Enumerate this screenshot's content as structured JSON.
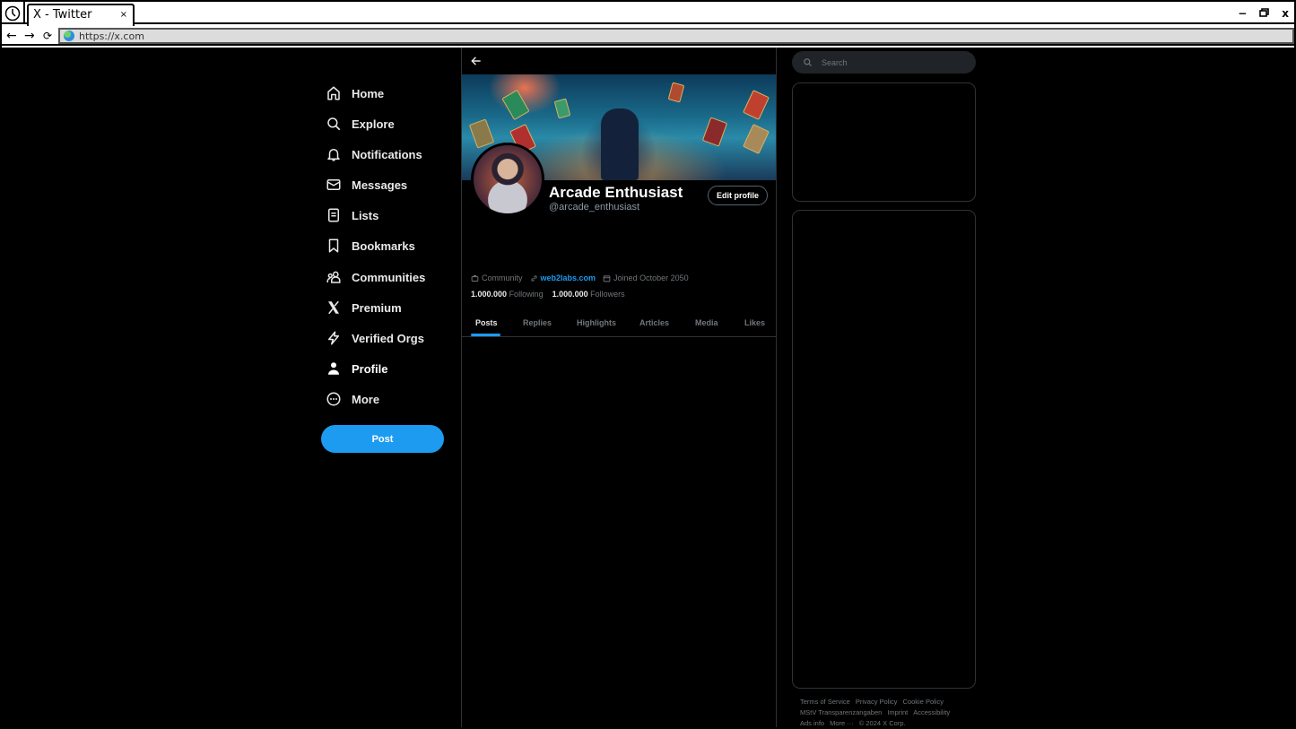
{
  "browser": {
    "tab_title": "X - Twitter",
    "tab_close": "×",
    "url": "https://x.com",
    "back": "←",
    "forward": "→",
    "reload": "⟳",
    "minimize": "−",
    "restore": "🗗",
    "close": "x"
  },
  "sidebar": {
    "items": [
      {
        "label": "Home",
        "icon": "home-icon"
      },
      {
        "label": "Explore",
        "icon": "search-icon"
      },
      {
        "label": "Notifications",
        "icon": "bell-icon"
      },
      {
        "label": "Messages",
        "icon": "envelope-icon"
      },
      {
        "label": "Lists",
        "icon": "list-icon"
      },
      {
        "label": "Bookmarks",
        "icon": "bookmark-icon"
      },
      {
        "label": "Communities",
        "icon": "communities-icon"
      },
      {
        "label": "Premium",
        "icon": "x-logo-icon"
      },
      {
        "label": "Verified Orgs",
        "icon": "lightning-icon"
      },
      {
        "label": "Profile",
        "icon": "person-icon"
      },
      {
        "label": "More",
        "icon": "more-circle-icon"
      }
    ],
    "post_label": "Post"
  },
  "profile": {
    "name": "Arcade Enthusiast",
    "handle": "@arcade_enthusiast",
    "edit_label": "Edit profile",
    "category": "Community",
    "website": "web2labs.com",
    "joined": "Joined October 2050",
    "following_count": "1.000.000",
    "following_label": "Following",
    "followers_count": "1.000.000",
    "followers_label": "Followers",
    "tabs": [
      "Posts",
      "Replies",
      "Highlights",
      "Articles",
      "Media",
      "Likes"
    ],
    "active_tab": "Posts"
  },
  "right": {
    "search_placeholder": "Search",
    "footer_links": [
      "Terms of Service",
      "Privacy Policy",
      "Cookie Policy",
      "MStV Transparenzangaben",
      "Imprint",
      "Accessibility",
      "Ads info",
      "More ···",
      "© 2024 X Corp."
    ]
  },
  "colors": {
    "accent": "#1d9bf0",
    "background": "#000000",
    "border": "#2f3336",
    "muted_text": "#71767b"
  }
}
